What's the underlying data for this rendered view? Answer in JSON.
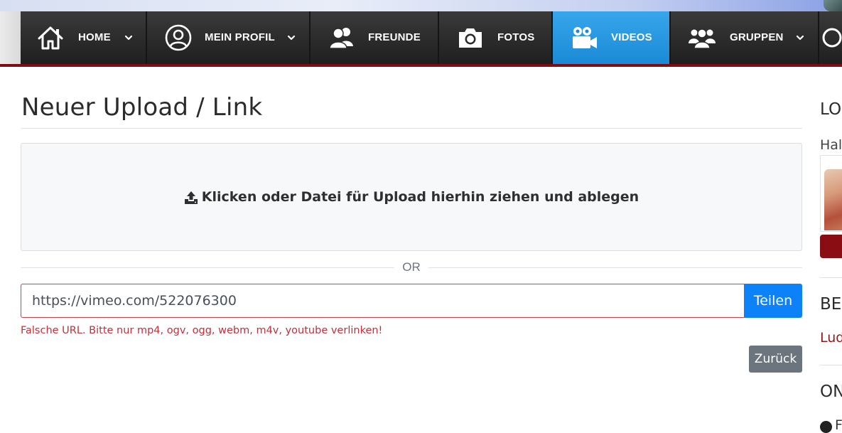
{
  "nav": {
    "items": [
      {
        "label": "HOME",
        "icon": "home-icon",
        "has_dropdown": true,
        "active": false
      },
      {
        "label": "MEIN PROFIL",
        "icon": "user-circle-icon",
        "has_dropdown": true,
        "active": false
      },
      {
        "label": "FREUNDE",
        "icon": "users-icon",
        "has_dropdown": false,
        "active": false
      },
      {
        "label": "FOTOS",
        "icon": "camera-icon",
        "has_dropdown": false,
        "active": false
      },
      {
        "label": "VIDEOS",
        "icon": "video-camera-icon",
        "has_dropdown": false,
        "active": true
      },
      {
        "label": "GRUPPEN",
        "icon": "group-icon",
        "has_dropdown": true,
        "active": false
      }
    ],
    "active_color": "#1b8ad6",
    "accent_line_color": "#7e0c12"
  },
  "main": {
    "title": "Neuer Upload / Link",
    "dropzone": {
      "icon": "upload-icon",
      "text": "Klicken oder Datei für Upload hierhin ziehen und ablegen"
    },
    "separator_text": "OR",
    "url_input": {
      "value": "https://vimeo.com/522076300",
      "placeholder": ""
    },
    "share_label": "Teilen",
    "error_text": "Falsche URL. Bitte nur mp4, ogv, ogg, webm, m4v, youtube verlinken!",
    "back_label": "Zurück"
  },
  "sidebar": {
    "heading_1": "LO",
    "greeting": "Hal",
    "heading_2": "BE",
    "link": "Lud",
    "heading_3": "ON",
    "dot_text": "F"
  },
  "colors": {
    "primary": "#0d81f7",
    "danger": "#c0303a",
    "secondary": "#6c757d",
    "brand_dark_red": "#8a0d14"
  }
}
